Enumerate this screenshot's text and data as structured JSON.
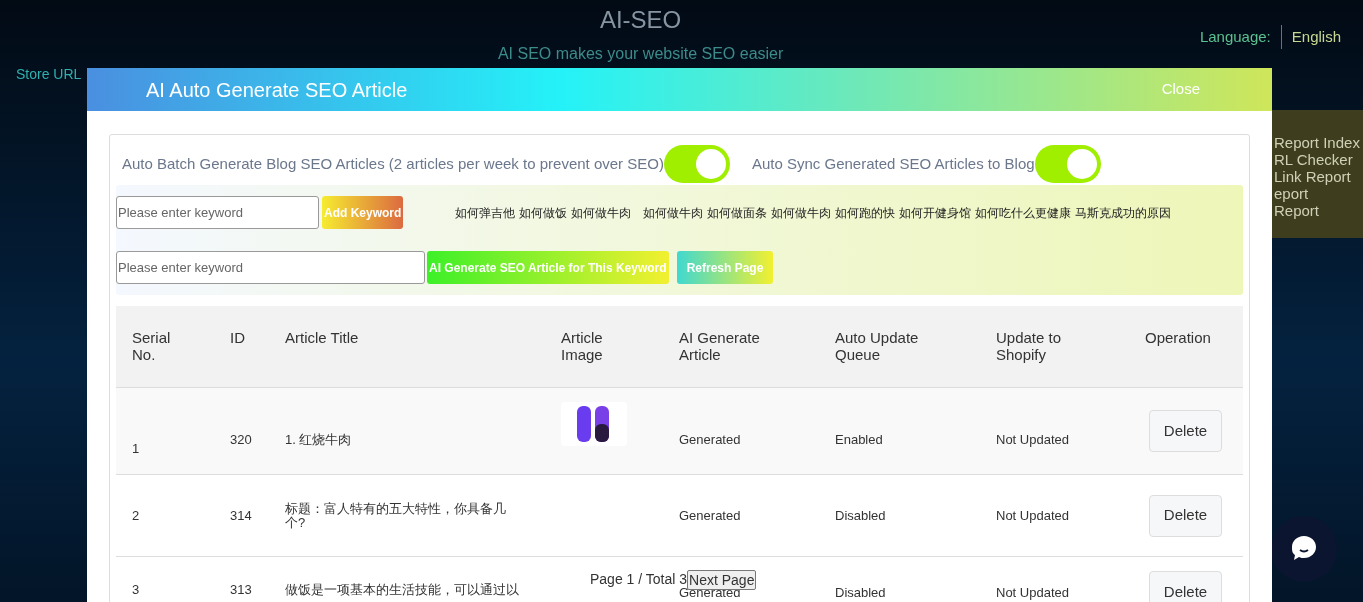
{
  "background": {
    "title": "AI-SEO",
    "subtitle": "AI SEO makes your website SEO easier",
    "language_label": "Language:",
    "language_value": "English",
    "store_label": "Store URL",
    "side_menu": [
      "Report Index",
      "RL Checker",
      "Link Report",
      "eport",
      "Report"
    ]
  },
  "modal": {
    "title": "AI Auto Generate SEO Article",
    "close": "Close",
    "toggles": [
      {
        "label": "Auto Batch Generate Blog SEO Articles (2 articles per week to prevent over SEO)",
        "on": true
      },
      {
        "label": "Auto Sync Generated SEO Articles to Blog",
        "on": true
      }
    ],
    "keyword_input": {
      "placeholder": "Please enter keyword"
    },
    "add_button": "Add Keyword",
    "keywords": [
      "如何弹吉他",
      "如何做饭",
      "如何做牛肉",
      "如何做牛肉",
      "如何做面条",
      "如何做牛肉",
      "如何跑的快",
      "如何开健身馆",
      "如何吃什么更健康",
      "马斯克成功的原因"
    ],
    "article_input": {
      "placeholder": "Please enter keyword"
    },
    "generate_button": "AI Generate SEO Article for This Keyword",
    "refresh_button": "Refresh Page",
    "table": {
      "columns": [
        "Serial No.",
        "ID",
        "Article Title",
        "Article Image",
        "AI Generate Article",
        "Auto Update Queue",
        "Update to Shopify",
        "Operation"
      ],
      "rows": [
        {
          "serial": "1",
          "id": "320",
          "title": "1. 红烧牛肉",
          "image": true,
          "generated": "Generated",
          "queue": "Enabled",
          "shopify": "Not Updated",
          "action": "Delete"
        },
        {
          "serial": "2",
          "id": "314",
          "title": "标题：富人特有的五大特性，你具备几个?",
          "image": false,
          "generated": "Generated",
          "queue": "Disabled",
          "shopify": "Not Updated",
          "action": "Delete"
        },
        {
          "serial": "3",
          "id": "313",
          "title": "做饭是一项基本的生活技能，可以通过以",
          "image": false,
          "generated": "Generated",
          "queue": "Disabled",
          "shopify": "Not Updated",
          "action": "Delete"
        }
      ]
    },
    "pagination": {
      "info": "Page 1 / Total 3",
      "next": "Next Page"
    }
  }
}
